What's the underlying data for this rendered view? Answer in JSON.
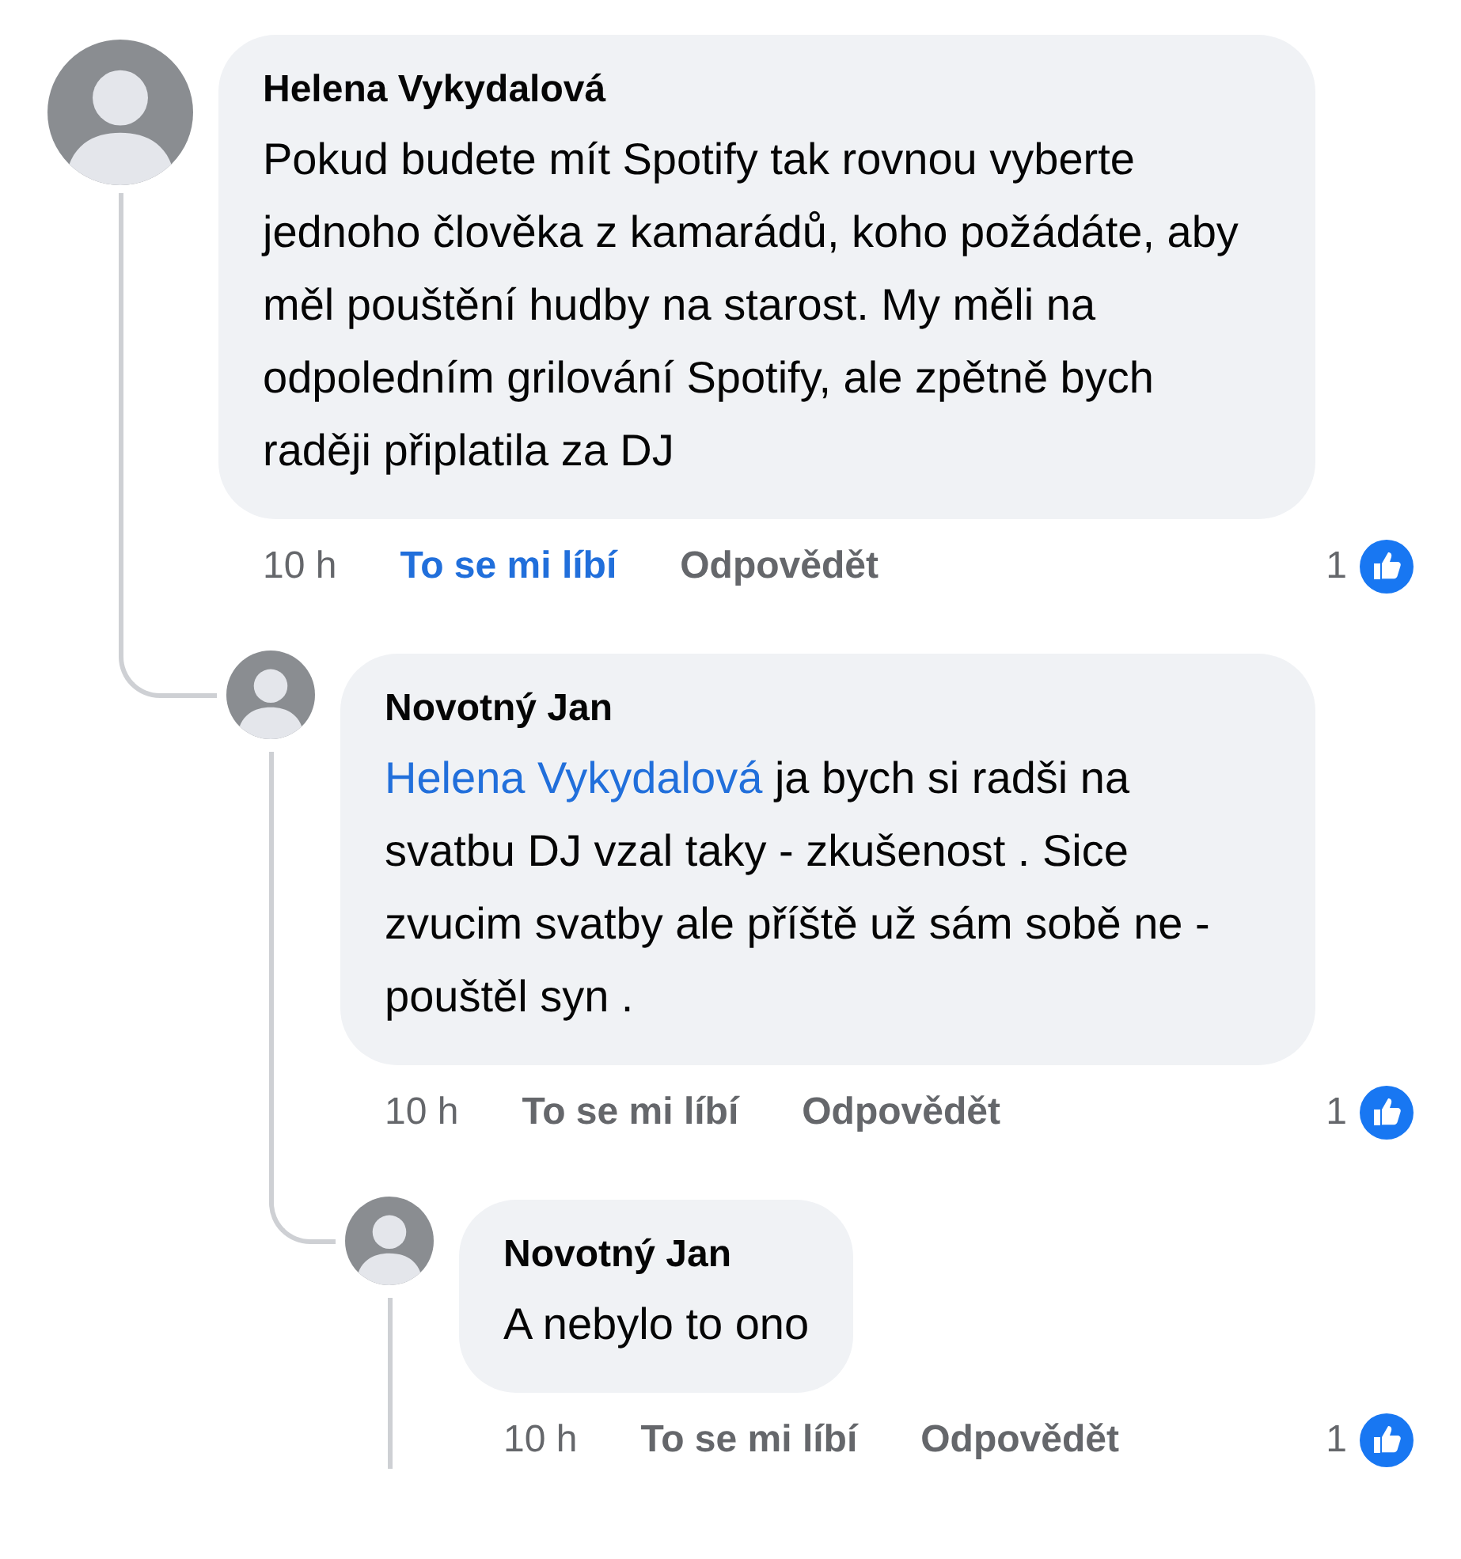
{
  "comments": [
    {
      "author": "Helena Vykydalová",
      "text": "Pokud budete mít Spotify tak rovnou vyberte jednoho člověka z kamarádů, koho požádáte, aby měl pouštění hudby na starost. My měli na odpoledním grilování Spotify, ale zpětně bych raději připlatila za DJ",
      "time": "10 h",
      "like_label": "To se mi líbí",
      "liked": true,
      "reply_label": "Odpovědět",
      "reaction_count": "1",
      "children": [
        {
          "author": "Novotný Jan",
          "mention": "Helena Vykydalová",
          "text": "ja bych si radši na svatbu DJ vzal taky - zkušenost . Sice zvucim svatby ale příště už sám sobě ne - pouštěl syn .",
          "time": "10 h",
          "like_label": "To se mi líbí",
          "liked": false,
          "reply_label": "Odpovědět",
          "reaction_count": "1",
          "children": [
            {
              "author": "Novotný Jan",
              "text": "A nebylo to ono",
              "time": "10 h",
              "like_label": "To se mi líbí",
              "liked": false,
              "reply_label": "Odpovědět",
              "reaction_count": "1",
              "thread_continues": true
            }
          ]
        }
      ]
    }
  ]
}
